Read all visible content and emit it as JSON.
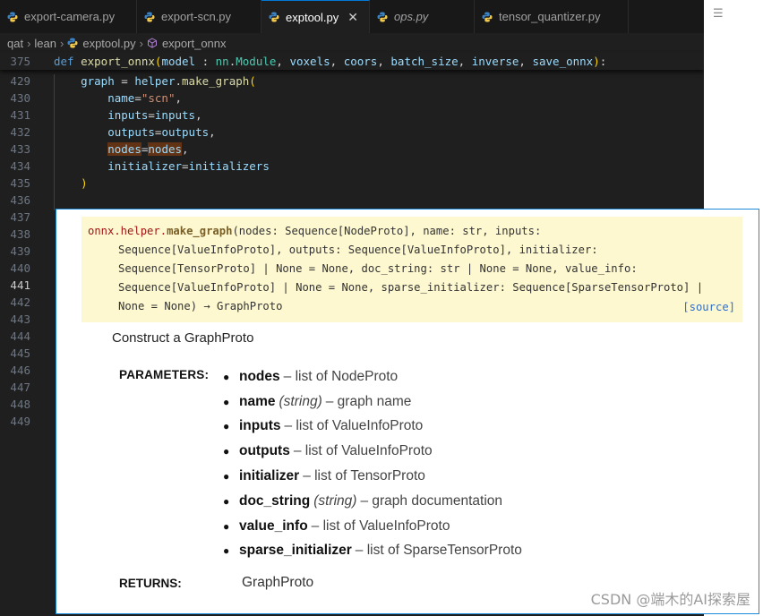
{
  "tabs": [
    {
      "label": "export-camera.py",
      "italic": false,
      "active": false
    },
    {
      "label": "export-scn.py",
      "italic": false,
      "active": false
    },
    {
      "label": "exptool.py",
      "italic": false,
      "active": true
    },
    {
      "label": "ops.py",
      "italic": true,
      "active": false
    },
    {
      "label": "tensor_quantizer.py",
      "italic": false,
      "active": false
    }
  ],
  "breadcrumb": {
    "items": [
      "qat",
      "lean",
      "exptool.py",
      "export_onnx"
    ]
  },
  "code": {
    "lines": [
      {
        "num": "375",
        "text": "def export_onnx(model : nn.Module, voxels, coors, batch_size, inverse, save_onnx):"
      },
      {
        "num": "429",
        "text": "    graph = helper.make_graph("
      },
      {
        "num": "430",
        "text": "        name=\"scn\","
      },
      {
        "num": "431",
        "text": "        inputs=inputs,"
      },
      {
        "num": "432",
        "text": "        outputs=outputs,"
      },
      {
        "num": "433",
        "text": "        nodes=nodes,"
      },
      {
        "num": "434",
        "text": "        initializer=initializers"
      },
      {
        "num": "435",
        "text": "    )"
      },
      {
        "num": "436",
        "text": ""
      },
      {
        "num": "437",
        "text": ""
      },
      {
        "num": "438",
        "text": ""
      },
      {
        "num": "439",
        "text": ""
      },
      {
        "num": "440",
        "text": ""
      },
      {
        "num": "441",
        "text": ""
      },
      {
        "num": "442",
        "text": ""
      },
      {
        "num": "443",
        "text": ""
      },
      {
        "num": "444",
        "text": ""
      },
      {
        "num": "445",
        "text": ""
      },
      {
        "num": "446",
        "text": ""
      },
      {
        "num": "447",
        "text": ""
      },
      {
        "num": "448",
        "text": ""
      },
      {
        "num": "449",
        "text": ""
      }
    ],
    "current_line": "441"
  },
  "popup": {
    "signature": {
      "module": "onnx.helper.",
      "func": "make_graph",
      "row1_rest": "(nodes: Sequence[NodeProto], name: str, inputs:",
      "row2": "Sequence[ValueInfoProto], outputs: Sequence[ValueInfoProto], initializer:",
      "row3": "Sequence[TensorProto] | None = None, doc_string: str | None = None, value_info:",
      "row4": "Sequence[ValueInfoProto] | None = None, sparse_initializer: Sequence[SparseTensorProto] |",
      "row5": "None = None) → GraphProto",
      "source_link": "[source]"
    },
    "description": "Construct a GraphProto",
    "params_label": "PARAMETERS:",
    "params": [
      {
        "name": "nodes",
        "type": "",
        "desc": "– list of NodeProto"
      },
      {
        "name": "name",
        "type": "(string)",
        "desc": "– graph name"
      },
      {
        "name": "inputs",
        "type": "",
        "desc": "– list of ValueInfoProto"
      },
      {
        "name": "outputs",
        "type": "",
        "desc": "– list of ValueInfoProto"
      },
      {
        "name": "initializer",
        "type": "",
        "desc": "– list of TensorProto"
      },
      {
        "name": "doc_string",
        "type": "(string)",
        "desc": "– graph documentation"
      },
      {
        "name": "value_info",
        "type": "",
        "desc": "– list of ValueInfoProto"
      },
      {
        "name": "sparse_initializer",
        "type": "",
        "desc": "– list of SparseTensorProto"
      }
    ],
    "returns_label": "RETURNS:",
    "returns_value": "GraphProto"
  },
  "watermark": "CSDN @端木的AI探索屋",
  "icons": {
    "tab_file": "python-file-icon",
    "breadcrumb_symbol": "symbol-method-icon",
    "menu": "more-actions-icon"
  },
  "colors": {
    "accent": "#0078d4",
    "popup_border": "#1c8bd6",
    "signature_bg": "#fdf8d0"
  }
}
